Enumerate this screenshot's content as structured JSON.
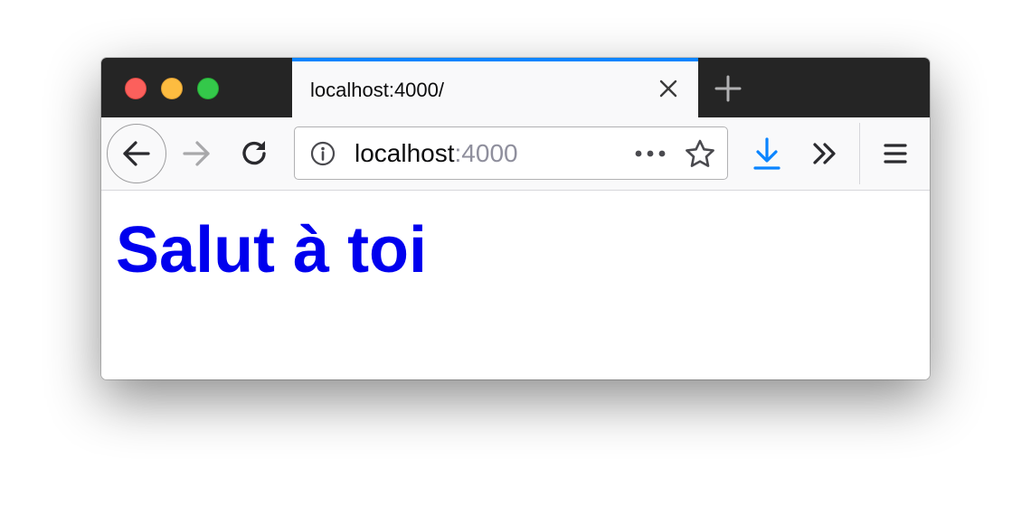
{
  "colors": {
    "tab_accent": "#0a84ff",
    "titlebar": "#252525",
    "toolbar": "#f9f9fa",
    "heading": "#0000ee",
    "download_icon": "#0a84ff"
  },
  "window_controls": {
    "close_icon": "traffic-light-red",
    "minimize_icon": "traffic-light-yellow",
    "zoom_icon": "traffic-light-green"
  },
  "tab": {
    "title": "localhost:4000/",
    "close_icon": "close-icon"
  },
  "new_tab_icon": "plus-icon",
  "toolbar": {
    "back_icon": "arrow-left-icon",
    "forward_icon": "arrow-right-icon",
    "reload_icon": "reload-icon",
    "download_icon": "download-icon",
    "overflow_icon": "chevron-double-right-icon",
    "menu_icon": "hamburger-menu-icon"
  },
  "urlbar": {
    "host": "localhost",
    "port": ":4000",
    "info_icon": "info-icon",
    "more_icon": "ellipsis-icon",
    "bookmark_icon": "star-icon"
  },
  "page": {
    "heading": "Salut à toi"
  }
}
